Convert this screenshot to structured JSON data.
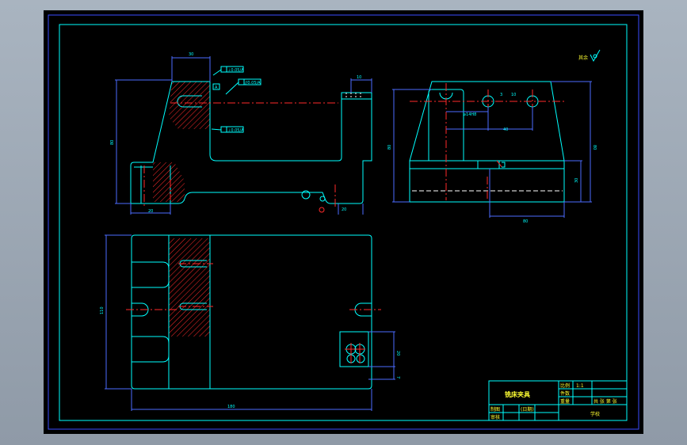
{
  "drawing": {
    "title": "铣床夹具",
    "scale_value": "1:1",
    "roughness_note": "其余",
    "tolerance_frames": [
      "⊥0.05/A",
      "//0.05/A",
      "⊥0.05/A"
    ],
    "datum_label": "A",
    "title_block": {
      "rows": [
        [
          "比例",
          "1:1"
        ],
        [
          "件数",
          ""
        ],
        [
          "重量",
          "",
          "共 张 第 张"
        ]
      ],
      "bottom": [
        "制图",
        "审核",
        "(日期)",
        "学校"
      ]
    }
  },
  "colors": {
    "outline": "#00ffff",
    "center_lines": "#ff2a2a",
    "dimensions": "#4b6bff",
    "hidden": "#ffffff",
    "text": "#ffff33",
    "paper": "#000000"
  }
}
